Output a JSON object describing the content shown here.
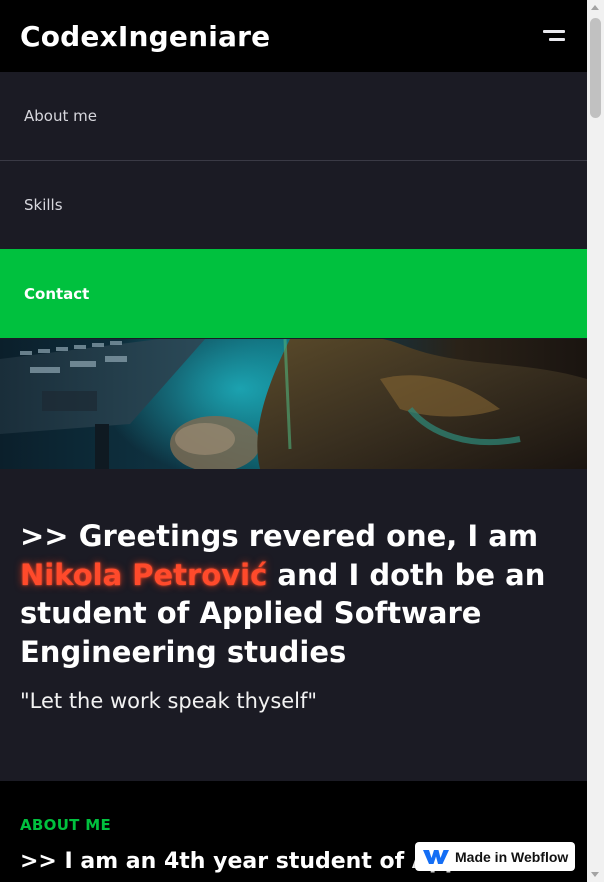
{
  "header": {
    "brand": "CodexIngeniare",
    "menu_icon": "menu-icon"
  },
  "nav": {
    "items": [
      {
        "label": "About me",
        "active": false
      },
      {
        "label": "Skills",
        "active": false
      },
      {
        "label": "Contact",
        "active": true
      }
    ]
  },
  "hero": {
    "headline_pre": ">> Greetings revered one, I am ",
    "name": "Nikola Petrović",
    "headline_post": " and I doth be an student of Applied Software Engineering studies",
    "quote": "\"Let the work speak thyself\""
  },
  "about": {
    "label": "ABOUT ME",
    "text": ">> I am an 4th year student of Applied"
  },
  "badge": {
    "text": "Made in Webflow",
    "icon": "webflow-logo-icon"
  },
  "colors": {
    "accent_green": "#00c13e",
    "name_red": "#ff4a2b",
    "panel_bg": "#1b1b24",
    "header_bg": "#000000"
  }
}
